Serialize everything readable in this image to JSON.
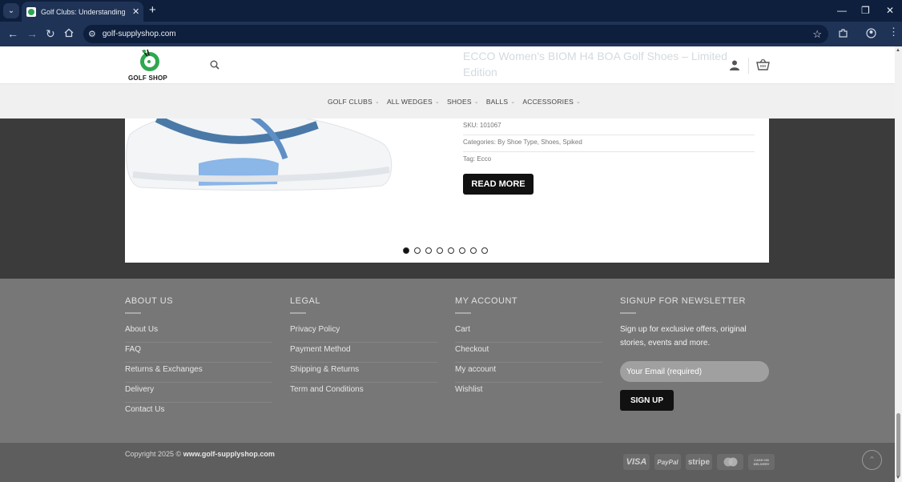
{
  "browser": {
    "tab_title": "Golf Clubs: Understanding the W",
    "tab_close": "✕",
    "new_tab": "+",
    "url": "golf-supplyshop.com",
    "minimize": "—",
    "restore": "❐",
    "close": "✕"
  },
  "header": {
    "logo_text": "GOLF SHOP",
    "faded_title": "ECCO Women's BIOM H4 BOA Golf Shoes – Limited Edition"
  },
  "nav": {
    "items": [
      {
        "label": "GOLF CLUBS"
      },
      {
        "label": "ALL WEDGES"
      },
      {
        "label": "SHOES"
      },
      {
        "label": "BALLS"
      },
      {
        "label": "ACCESSORIES"
      }
    ],
    "chevron": "⌄"
  },
  "product": {
    "sku": "SKU: 101067",
    "categories": "Categories: By Shoe Type, Shoes, Spiked",
    "tag": "Tag: Ecco",
    "read_more": "READ MORE",
    "slides": 8,
    "active_slide": 1
  },
  "footer": {
    "about": {
      "title": "ABOUT US",
      "links": [
        "About Us",
        "FAQ",
        "Returns & Exchanges",
        "Delivery",
        "Contact Us"
      ]
    },
    "legal": {
      "title": "LEGAL",
      "links": [
        "Privacy Policy",
        "Payment Method",
        "Shipping & Returns",
        "Term and Conditions"
      ]
    },
    "account": {
      "title": "MY ACCOUNT",
      "links": [
        "Cart",
        "Checkout",
        "My account",
        "Wishlist"
      ]
    },
    "newsletter": {
      "title": "SIGNUP FOR NEWSLETTER",
      "text": "Sign up for exclusive offers, original stories, events and more.",
      "email_placeholder": "Your Email (required)",
      "signup": "SIGN UP"
    }
  },
  "bottom": {
    "copyright_prefix": "Copyright 2025 © ",
    "copyright_site": "www.golf-supplyshop.com",
    "payments": [
      "VISA",
      "PayPal",
      "stripe",
      "mastercard",
      "CASH ON DELIVERY"
    ],
    "to_top": "⌃"
  }
}
